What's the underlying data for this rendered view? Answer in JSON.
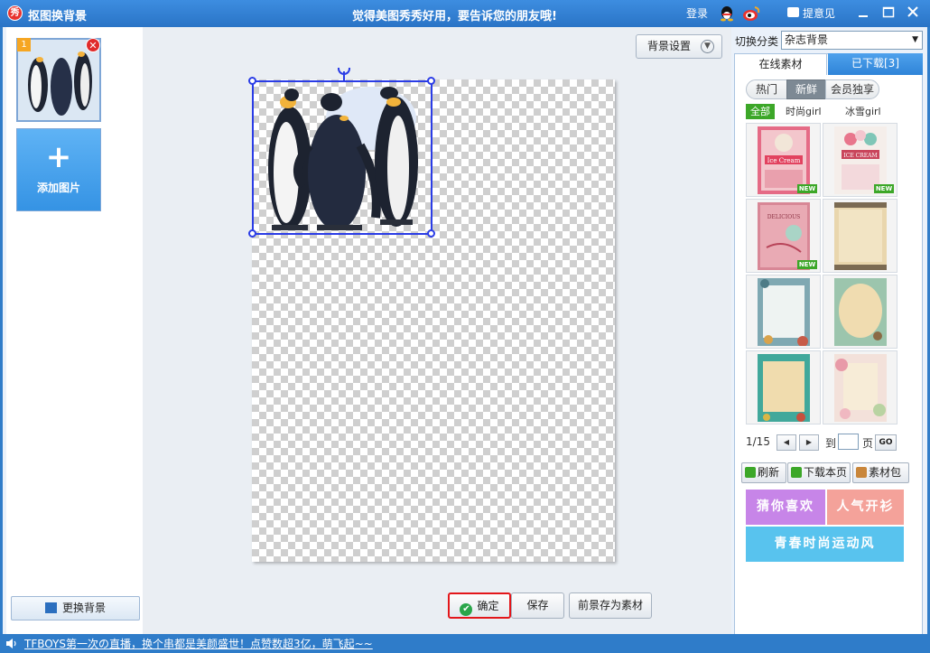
{
  "titlebar": {
    "app_title": "抠图换背景",
    "slogan": "觉得美图秀秀好用，要告诉您的朋友哦!",
    "login": "登录",
    "feedback": "提意见",
    "logo_char": "秀"
  },
  "left": {
    "thumb_index": "1",
    "add_image_label": "添加图片",
    "change_bg_label": "更换背景"
  },
  "canvas": {
    "bg_settings_label": "背景设置",
    "ok_label": "确定",
    "save_label": "保存",
    "save_as_material_label": "前景存为素材"
  },
  "right": {
    "category_label": "切换分类",
    "category_value": "杂志背景",
    "tabs": [
      {
        "label": "在线素材",
        "active": true
      },
      {
        "label": "已下载[3]",
        "active": false
      }
    ],
    "sub_tabs": [
      "热门",
      "新鲜",
      "会员独享"
    ],
    "filters": [
      "全部",
      "时尚girl",
      "冰雪girl"
    ],
    "tiles": [
      {
        "id": "ice-cream-pink",
        "new": true,
        "text": "Ice Cream"
      },
      {
        "id": "ice-cream-white",
        "new": true,
        "text": "ICE CREAM"
      },
      {
        "id": "delicious",
        "new": true,
        "text": "DELICIOUS"
      },
      {
        "id": "vintage-paper",
        "new": false,
        "text": ""
      },
      {
        "id": "floral-blue",
        "new": false,
        "text": ""
      },
      {
        "id": "bird-cream",
        "new": false,
        "text": ""
      },
      {
        "id": "teal-frame",
        "new": false,
        "text": ""
      },
      {
        "id": "flower-pink",
        "new": false,
        "text": ""
      }
    ],
    "new_tag": "NEW",
    "pager": {
      "current": "1/15",
      "to": "到",
      "page": "页",
      "go": "GO"
    },
    "actions": [
      "刷新",
      "下载本页",
      "素材包"
    ],
    "promos": [
      "猜你喜欢",
      "人气开衫",
      "青春时尚运动风"
    ]
  },
  "status": {
    "news": "TFBOYS第一次の直播，换个串都是美颜盛世！点赞数超3亿，萌飞起~~"
  },
  "colors": {
    "accent": "#2f7cc9",
    "selection": "#2a3ce6",
    "highlight": "#e3161a",
    "new_tag": "#3ca728"
  }
}
